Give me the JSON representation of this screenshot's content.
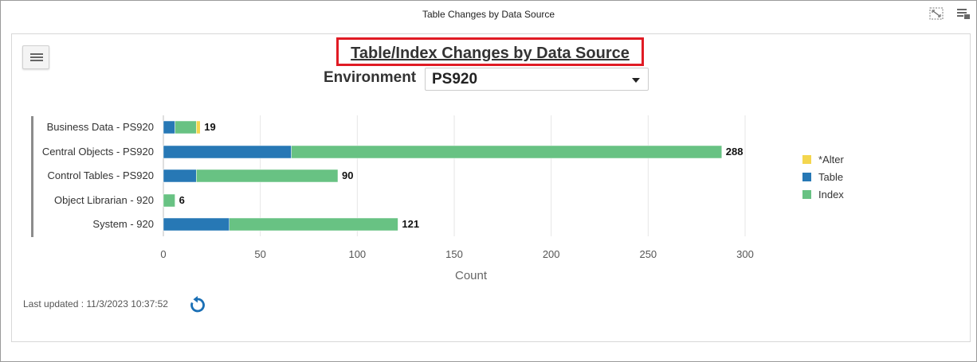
{
  "window": {
    "title": "Table Changes by Data Source",
    "icons": [
      "fullscreen-icon",
      "options-icon"
    ]
  },
  "header": {
    "title": "Table/Index Changes by Data Source",
    "environment_label": "Environment",
    "environment_value": "PS920"
  },
  "chart_data": {
    "type": "bar",
    "orientation": "horizontal",
    "stacked": true,
    "categories": [
      "Business Data - PS920",
      "Central Objects - PS920",
      "Control Tables - PS920",
      "Object Librarian - 920",
      "System - 920"
    ],
    "series": [
      {
        "name": "Table",
        "color": "#2778b5",
        "values": [
          6,
          66,
          17,
          0,
          34
        ]
      },
      {
        "name": "Index",
        "color": "#68c283",
        "values": [
          11,
          222,
          73,
          6,
          87
        ]
      },
      {
        "name": "*Alter",
        "color": "#f4d64e",
        "values": [
          2,
          0,
          0,
          0,
          0
        ]
      }
    ],
    "totals": [
      19,
      288,
      90,
      6,
      121
    ],
    "legend": [
      "*Alter",
      "Table",
      "Index"
    ],
    "legend_position": "right",
    "xlabel": "Count",
    "xlim": [
      0,
      300
    ],
    "xticks": [
      0,
      50,
      100,
      150,
      200,
      250,
      300
    ],
    "grid": true
  },
  "footer": {
    "last_updated": "Last updated : 11/3/2023 10:37:52",
    "refresh_icon": "refresh-icon"
  }
}
